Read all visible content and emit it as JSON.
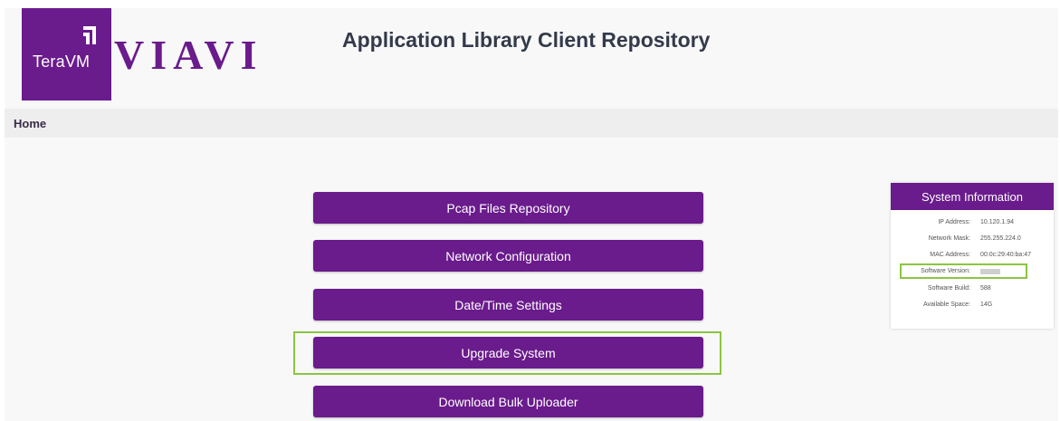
{
  "header": {
    "logo_text": "TeraVM",
    "brand": "VIAVI",
    "title": "Application Library Client Repository"
  },
  "nav": {
    "home": "Home"
  },
  "menu": {
    "buttons": [
      {
        "label": "Pcap Files Repository"
      },
      {
        "label": "Network Configuration"
      },
      {
        "label": "Date/Time Settings"
      },
      {
        "label": "Upgrade System"
      },
      {
        "label": "Download Bulk Uploader"
      }
    ]
  },
  "system_info": {
    "title": "System Information",
    "rows": [
      {
        "label": "IP Address:",
        "value": "10.120.1.94"
      },
      {
        "label": "Network Mask:",
        "value": "255.255.224.0"
      },
      {
        "label": "MAC Address:",
        "value": "00:0c:29:40:ba:47"
      },
      {
        "label": "Software Version:",
        "value": ""
      },
      {
        "label": "Software Build:",
        "value": "588"
      },
      {
        "label": "Available Space:",
        "value": "14G"
      }
    ]
  },
  "colors": {
    "brand_purple": "#6a1b8c",
    "highlight_green": "#8ac640"
  }
}
